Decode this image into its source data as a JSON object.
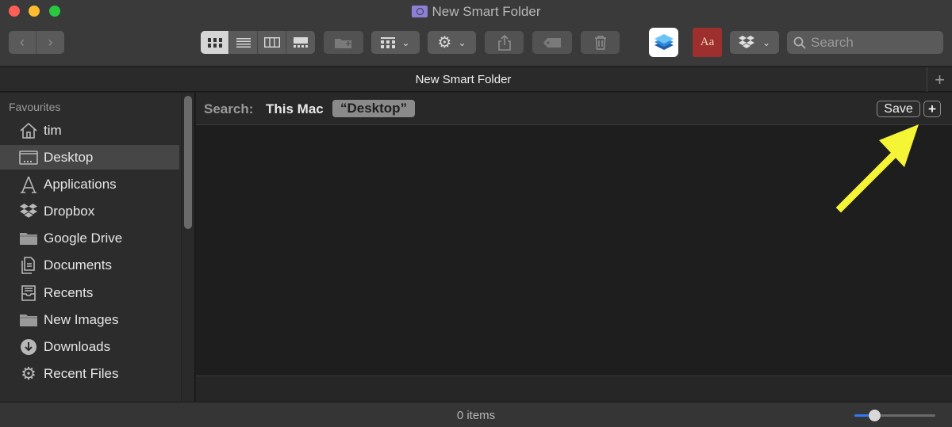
{
  "window": {
    "title": "New Smart Folder"
  },
  "toolbar": {
    "back_icon": "chevron-left-icon",
    "forward_icon": "chevron-right-icon",
    "view_modes": [
      "icon-view",
      "list-view",
      "column-view",
      "gallery-view"
    ],
    "active_view": "icon-view",
    "search_placeholder": "Search"
  },
  "tab": {
    "label": "New Smart Folder"
  },
  "sidebar": {
    "heading": "Favourites",
    "items": [
      {
        "label": "tim",
        "icon": "home-icon"
      },
      {
        "label": "Desktop",
        "icon": "desktop-icon",
        "selected": true
      },
      {
        "label": "Applications",
        "icon": "applications-icon"
      },
      {
        "label": "Dropbox",
        "icon": "dropbox-icon"
      },
      {
        "label": "Google Drive",
        "icon": "folder-icon"
      },
      {
        "label": "Documents",
        "icon": "documents-icon"
      },
      {
        "label": "Recents",
        "icon": "recents-icon"
      },
      {
        "label": "New Images",
        "icon": "folder-icon"
      },
      {
        "label": "Downloads",
        "icon": "downloads-icon"
      },
      {
        "label": "Recent Files",
        "icon": "gear-icon"
      }
    ]
  },
  "scope": {
    "label": "Search:",
    "option_mac": "This Mac",
    "option_desktop": "“Desktop”",
    "save_label": "Save",
    "add_label": "+"
  },
  "status": {
    "text": "0 items",
    "zoom_level": 0.25
  },
  "colors": {
    "accent": "#3478f6",
    "annotation_arrow": "#f5f536"
  }
}
